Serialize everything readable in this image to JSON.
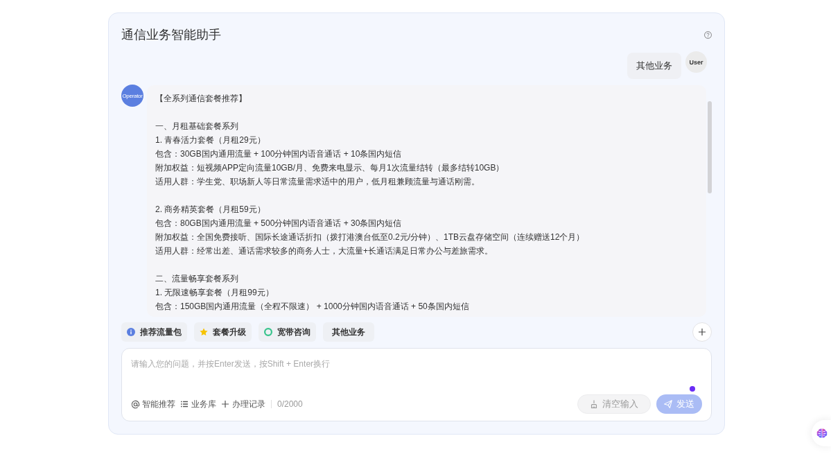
{
  "header": {
    "title": "通信业务智能助手"
  },
  "messages": [
    {
      "kind": "user",
      "avatar": "User",
      "text": "其他业务"
    },
    {
      "kind": "operator",
      "avatar": "Operator",
      "paragraphs": [
        [
          "【全系列通信套餐推荐】"
        ],
        [
          "一、月租基础套餐系列",
          "1. 青春活力套餐（月租29元）",
          "包含：30GB国内通用流量 + 100分钟国内语音通话 + 10条国内短信",
          "附加权益：短视频APP定向流量10GB/月、免费来电显示、每月1次流量结转（最多结转10GB）",
          "适用人群：学生党、职场新人等日常流量需求适中的用户，低月租兼顾流量与通话刚需。"
        ],
        [
          "2. 商务精英套餐（月租59元）",
          "包含：80GB国内通用流量 + 500分钟国内语音通话 + 30条国内短信",
          "附加权益：全国免费接听、国际长途通话折扣（拨打港澳台低至0.2元/分钟）、1TB云盘存储空间（连续赠送12个月）",
          "适用人群：经常出差、通话需求较多的商务人士，大流量+长通话满足日常办公与差旅需求。"
        ],
        [
          "二、流量畅享套餐系列",
          "1. 无限速畅享套餐（月租99元）",
          "包含：150GB国内通用流量（全程不限速） + 1000分钟国内语音通话 + 50条国内短信"
        ]
      ]
    }
  ],
  "quick_replies": [
    {
      "kind": "info",
      "label": "推荐流量包"
    },
    {
      "kind": "star",
      "label": "套餐升级"
    },
    {
      "kind": "ring",
      "label": "宽带咨询"
    },
    {
      "kind": "plain",
      "label": "其他业务"
    }
  ],
  "composer": {
    "placeholder": "请输入您的问题，并按Enter发送，按Shift + Enter换行",
    "tools": [
      {
        "kind": "mention",
        "label": "智能推荐"
      },
      {
        "kind": "list",
        "label": "业务库"
      },
      {
        "kind": "add",
        "label": "办理记录"
      }
    ],
    "count": "0/2000",
    "buttons": [
      {
        "kind": "clear",
        "label": "清空输入",
        "disabled": true
      },
      {
        "kind": "send",
        "label": "发送",
        "disabled": true
      }
    ]
  }
}
